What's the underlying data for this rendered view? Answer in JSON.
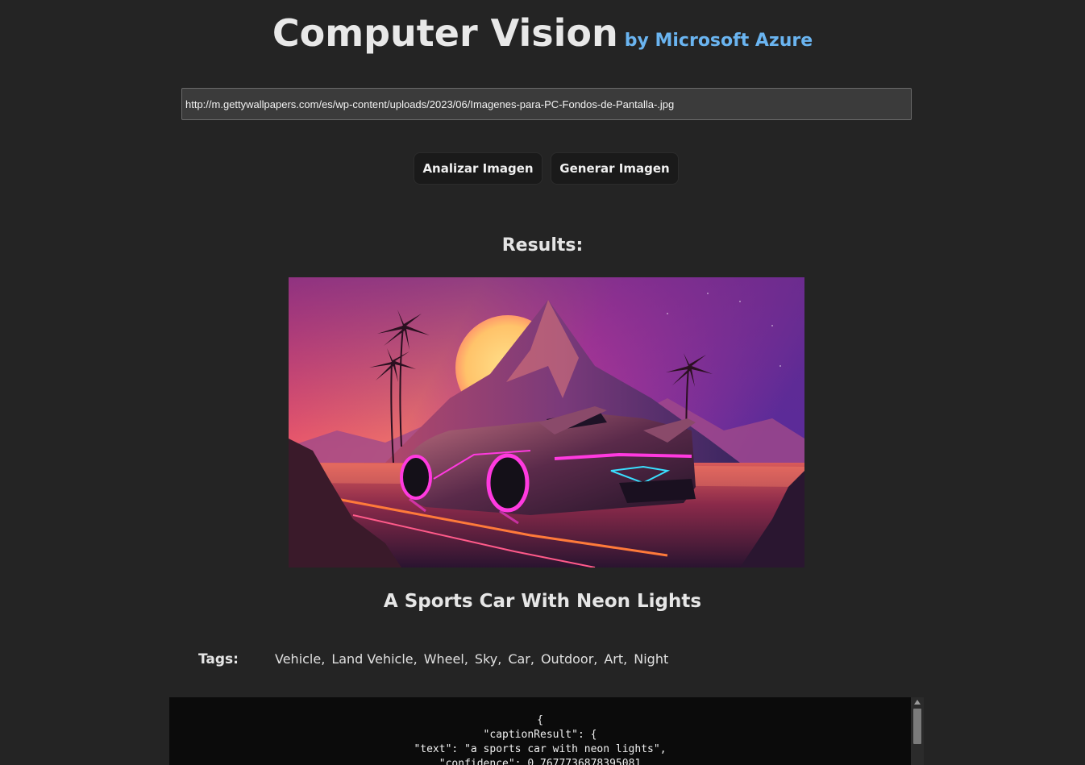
{
  "header": {
    "title": "Computer Vision",
    "subtitle": "by Microsoft Azure"
  },
  "url_input": {
    "value": "http://m.gettywallpapers.com/es/wp-content/uploads/2023/06/Imagenes-para-PC-Fondos-de-Pantalla-.jpg"
  },
  "buttons": {
    "analyze": "Analizar Imagen",
    "generate": "Generar Imagen"
  },
  "results": {
    "heading": "Results:",
    "image_alt": "neon sports car in front of mountain at sunset",
    "caption": "A Sports Car With Neon Lights",
    "tags_label": "Tags:",
    "tags": [
      "Vehicle,",
      "Land Vehicle,",
      "Wheel,",
      "Sky,",
      "Car,",
      "Outdoor,",
      "Art,",
      "Night"
    ],
    "json_lines": [
      "{",
      "\"captionResult\": {",
      "\"text\": \"a sports car with neon lights\",",
      "\"confidence\": 0.7677736878395081"
    ]
  },
  "colors": {
    "background": "#242424",
    "accent": "#6ab4f0",
    "button_bg": "#1a1a1a",
    "json_bg": "#0b0b0b"
  },
  "icons": {
    "scroll_up": "triangle-up-icon"
  }
}
